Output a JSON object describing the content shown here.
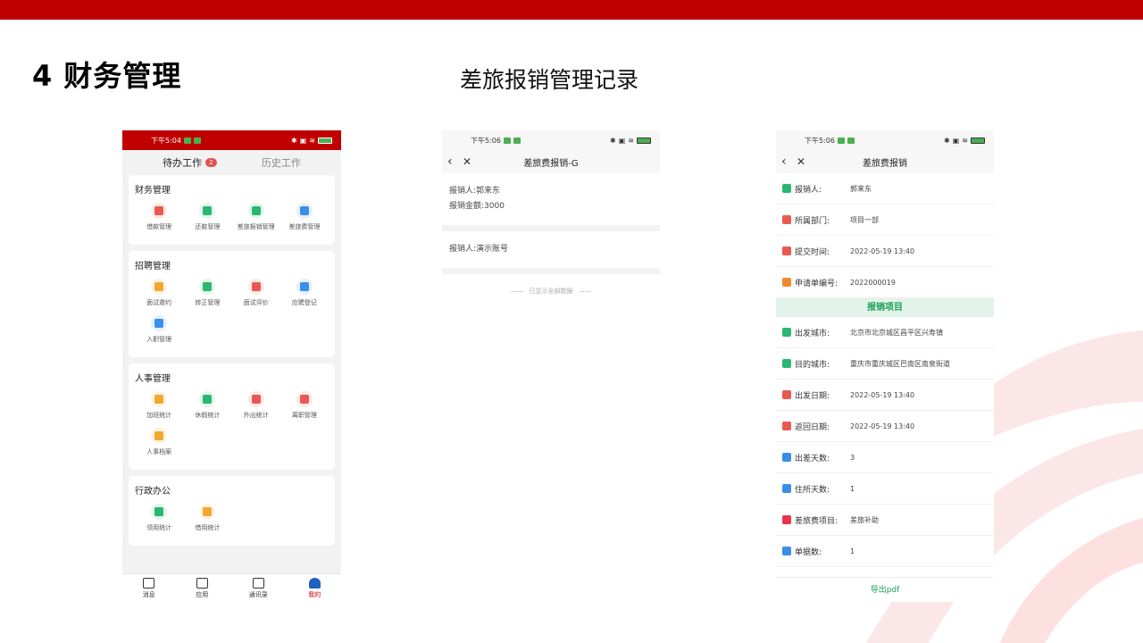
{
  "slide": {
    "title": "4 财务管理",
    "subtitle": "差旅报销管理记录"
  },
  "phone1": {
    "status_time": "下午5:04",
    "tabs": {
      "pending": "待办工作",
      "pending_count": "2",
      "history": "历史工作"
    },
    "sections": [
      {
        "title": "财务管理",
        "items": [
          {
            "label": "借款管理",
            "color": "#e85a4f"
          },
          {
            "label": "还款管理",
            "color": "#2bb673"
          },
          {
            "label": "差旅报销管理",
            "color": "#2bb673"
          },
          {
            "label": "差旅费管理",
            "color": "#3a8ee6"
          }
        ]
      },
      {
        "title": "招聘管理",
        "items": [
          {
            "label": "面试邀约",
            "color": "#f0a830"
          },
          {
            "label": "转正管理",
            "color": "#2bb673"
          },
          {
            "label": "面试评价",
            "color": "#e85a4f"
          },
          {
            "label": "应聘登记",
            "color": "#3a8ee6"
          },
          {
            "label": "入职管理",
            "color": "#3a8ee6"
          }
        ]
      },
      {
        "title": "人事管理",
        "items": [
          {
            "label": "加班统计",
            "color": "#f0a830"
          },
          {
            "label": "休假统计",
            "color": "#2bb673"
          },
          {
            "label": "外出统计",
            "color": "#e85a4f"
          },
          {
            "label": "离职管理",
            "color": "#e85a4f"
          },
          {
            "label": "人事档案",
            "color": "#f0a830"
          }
        ]
      },
      {
        "title": "行政办公",
        "items": [
          {
            "label": "领用统计",
            "color": "#2bb673"
          },
          {
            "label": "借用统计",
            "color": "#f0a830"
          }
        ]
      }
    ],
    "nav": {
      "messages": "消息",
      "apps": "应用",
      "contacts": "通讯录",
      "mine": "我的"
    }
  },
  "phone2": {
    "status_time": "下午5:06",
    "title": "差旅费报销-G",
    "records": [
      {
        "line1": "报销人:郭来东",
        "line2": "报销金额:3000"
      },
      {
        "line1": "报销人:演示账号",
        "line2": ""
      }
    ],
    "end_note": "已显示全部数据"
  },
  "phone3": {
    "status_time": "下午5:06",
    "title": "差旅费报销",
    "rows_top": [
      {
        "label": "报销人:",
        "value": "郭来东",
        "color": "#2bb673"
      },
      {
        "label": "所属部门:",
        "value": "项目一部",
        "color": "#e85a4f"
      },
      {
        "label": "提交时间:",
        "value": "2022-05-19 13:40",
        "color": "#e85a4f"
      },
      {
        "label": "申请单编号:",
        "value": "2022000019",
        "color": "#f08a30"
      }
    ],
    "section_title": "报销项目",
    "rows_bottom": [
      {
        "label": "出发城市:",
        "value": "北京市北京城区昌平区兴寿镇",
        "color": "#2bb673"
      },
      {
        "label": "目的城市:",
        "value": "重庆市重庆城区巴南区南泉街道",
        "color": "#2bb673"
      },
      {
        "label": "出发日期:",
        "value": "2022-05-19 13:40",
        "color": "#e85a4f"
      },
      {
        "label": "返回日期:",
        "value": "2022-05-19 13:40",
        "color": "#e85a4f"
      },
      {
        "label": "出差天数:",
        "value": "3",
        "color": "#3a8ee6"
      },
      {
        "label": "住所天数:",
        "value": "1",
        "color": "#3a8ee6"
      },
      {
        "label": "差旅费项目:",
        "value": "差旅补助",
        "color": "#e8344f"
      },
      {
        "label": "单据数:",
        "value": "1",
        "color": "#3a8ee6"
      }
    ],
    "export_label": "导出pdf"
  }
}
